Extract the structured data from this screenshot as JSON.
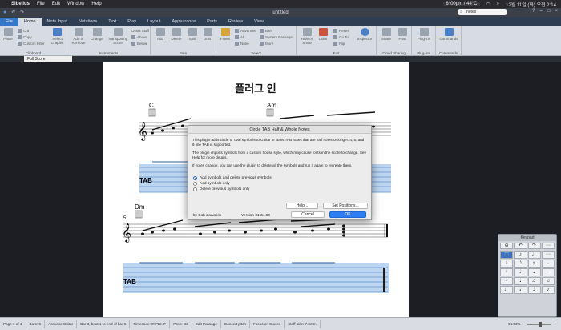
{
  "menubar": {
    "app": "Sibelius",
    "items": [
      "File",
      "Edit",
      "Window",
      "Help"
    ],
    "status": "6°00pm / 44°C",
    "clock": "12월 11일 (화) 오전 2:14"
  },
  "window": {
    "title": "untitled",
    "search_value": "notes"
  },
  "tabs": [
    "File",
    "Home",
    "Note Input",
    "Notations",
    "Text",
    "Play",
    "Layout",
    "Appearance",
    "Parts",
    "Review",
    "View"
  ],
  "ribbon": {
    "clipboard": {
      "name": "Clipboard",
      "paste": "Paste",
      "cut": "Cut",
      "copy": "Copy",
      "custom_filter": "Custom Filter",
      "select_graphic": "Select Graphic"
    },
    "instruments": {
      "name": "Instruments",
      "add_remove": "Add or Remove",
      "change": "Change",
      "transposing": "Transposing Score",
      "ossia_staff": "Ossia Staff",
      "above": "Above",
      "below": "Below"
    },
    "bars": {
      "name": "Bars",
      "add": "Add",
      "delete": "Delete",
      "split": "Split",
      "join": "Join"
    },
    "select": {
      "name": "Select",
      "filters": "Filters",
      "advanced": "Advanced",
      "all": "All",
      "none": "None",
      "bars": "Bars",
      "system_passage": "System Passage",
      "more": "More"
    },
    "edit": {
      "name": "Edit",
      "hide_show": "Hide or Show",
      "color": "Color",
      "reset": "Reset",
      "goto": "Go To",
      "flip": "Flip",
      "inspector": "Inspector"
    },
    "cloud": {
      "name": "Cloud Sharing",
      "share": "Share",
      "post": "Post"
    },
    "plugins": {
      "name": "Plug-ins",
      "plugins": "Plug-ins"
    },
    "commands": {
      "name": "Commands",
      "commands": "Commands"
    }
  },
  "doc_tab": "Full Score",
  "score": {
    "title": "플러그 인",
    "chord1": "C",
    "chord2": "Am",
    "chord3": "Dm",
    "bar_number": "5"
  },
  "dialog": {
    "title": "Circle TAB Half & Whole Notes",
    "p1": "This plugin adds circle or oval symbols to Guitar or Bass TAB notes that are half notes or longer. 4, 5, and 6 line TAB is supported.",
    "p2": "The plugin imports symbols from a custom house style, which may cause fonts in the score to change. See Help for more details.",
    "p3": "If notes change, you can use the plugin to delete all the symbols and run it again to recreate them.",
    "options": [
      {
        "label": "Add symbols and delete previous symbols",
        "selected": true
      },
      {
        "label": "Add symbols only",
        "selected": false
      },
      {
        "label": "Delete previous symbols only",
        "selected": false
      }
    ],
    "help": "Help...",
    "set_positions": "Set Positions...",
    "cancel": "Cancel",
    "ok": "OK",
    "author": "by Bob Zawalich",
    "version": "Version 01.34.00"
  },
  "keypad": {
    "title": "Keypad",
    "top": [
      "⊕",
      "↶",
      "↷",
      "⋯"
    ],
    "keys": [
      "⬚",
      "♪",
      "♩",
      "⋯",
      "♭",
      "𝅘𝅥𝅮",
      "♯",
      "·",
      "♮",
      "𝅗𝅥",
      "𝅝",
      "⌢",
      "𝄽",
      "𝅘𝅥",
      "♬",
      "♫",
      "♩",
      "𝅗𝅥",
      "𝅘𝅥𝅯",
      "♪"
    ]
  },
  "status": {
    "page": "Page 1 of 1",
    "bars": "Bars: 5",
    "instrument": "Acoustic Guitar",
    "selection": "Bar 3, beat 1 to end of bar 5",
    "timecode": "Timecode: 0'0\"12.0\"",
    "pitch": "Pitch: C3",
    "edit": "Edit Passage",
    "concert": "Concert pitch",
    "focus": "Focus on Staves",
    "staff_size": "Staff size: 7.0mm",
    "zoom": "95.53%"
  }
}
